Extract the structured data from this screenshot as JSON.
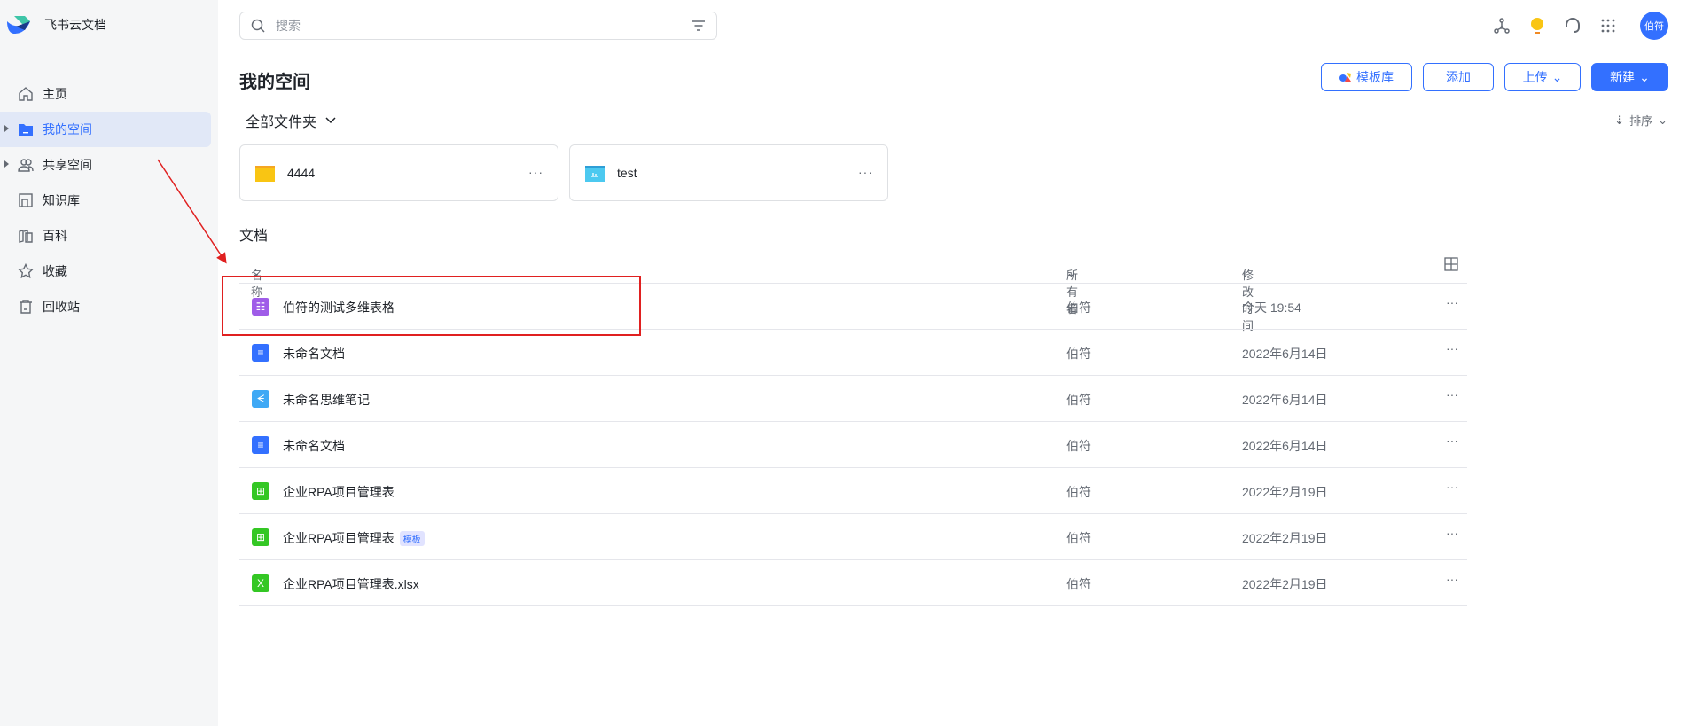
{
  "app": {
    "name": "飞书云文档"
  },
  "sidebar": {
    "items": [
      {
        "label": "主页"
      },
      {
        "label": "我的空间"
      },
      {
        "label": "共享空间"
      },
      {
        "label": "知识库"
      },
      {
        "label": "百科"
      },
      {
        "label": "收藏"
      },
      {
        "label": "回收站"
      }
    ]
  },
  "search": {
    "placeholder": "搜索"
  },
  "user": {
    "avatar": "伯符"
  },
  "page": {
    "title": "我的空间"
  },
  "actions": {
    "templates": "模板库",
    "add": "添加",
    "upload": "上传",
    "create": "新建"
  },
  "folders": {
    "header": "全部文件夹",
    "sort": "排序",
    "items": [
      {
        "name": "4444",
        "color": "#f9c513"
      },
      {
        "name": "test",
        "color": "#4cc9f0"
      }
    ]
  },
  "docs": {
    "label": "文档",
    "columns": {
      "name": "名称",
      "owner": "所有者",
      "time": "修改时间"
    },
    "rows": [
      {
        "name": "伯符的测试多维表格",
        "owner": "伯符",
        "time": "今天 19:54",
        "type": "bitable",
        "color": "#9f5ce8"
      },
      {
        "name": "未命名文档",
        "owner": "伯符",
        "time": "2022年6月14日",
        "type": "doc",
        "color": "#3370ff"
      },
      {
        "name": "未命名思维笔记",
        "owner": "伯符",
        "time": "2022年6月14日",
        "type": "mindnote",
        "color": "#3fa9f5"
      },
      {
        "name": "未命名文档",
        "owner": "伯符",
        "time": "2022年6月14日",
        "type": "doc",
        "color": "#3370ff"
      },
      {
        "name": "企业RPA项目管理表",
        "owner": "伯符",
        "time": "2022年2月19日",
        "type": "sheet",
        "color": "#34c724"
      },
      {
        "name": "企业RPA项目管理表",
        "tag": "模板",
        "owner": "伯符",
        "time": "2022年2月19日",
        "type": "sheet",
        "color": "#34c724"
      },
      {
        "name": "企业RPA项目管理表.xlsx",
        "owner": "伯符",
        "time": "2022年2月19日",
        "type": "xlsx",
        "color": "#34c724"
      }
    ]
  }
}
